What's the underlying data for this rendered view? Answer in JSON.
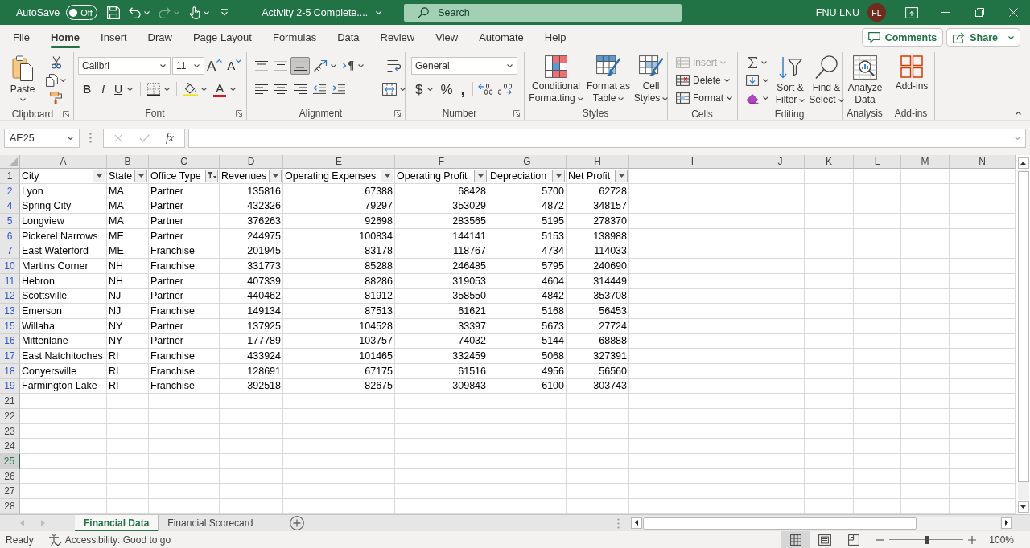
{
  "title_bar": {
    "autosave_label": "AutoSave",
    "autosave": {
      "on": false,
      "label": "Off"
    },
    "quick_access": [
      {
        "kind": "save",
        "disabled": false
      },
      {
        "kind": "undo",
        "disabled": false
      },
      {
        "kind": "redo",
        "disabled": true
      },
      {
        "kind": "touch",
        "disabled": false
      },
      {
        "kind": "customize",
        "disabled": false
      }
    ],
    "document_title": "Activity 2-5 Complete....",
    "search": {
      "placeholder": "Search"
    },
    "user_name": "FNU LNU",
    "avatar_initials": "FL"
  },
  "ribbon_tabs": [
    {
      "label": "File",
      "selected": false
    },
    {
      "label": "Home",
      "selected": true
    },
    {
      "label": "Insert",
      "selected": false
    },
    {
      "label": "Draw",
      "selected": false
    },
    {
      "label": "Page Layout",
      "selected": false
    },
    {
      "label": "Formulas",
      "selected": false
    },
    {
      "label": "Data",
      "selected": false
    },
    {
      "label": "Review",
      "selected": false
    },
    {
      "label": "View",
      "selected": false
    },
    {
      "label": "Automate",
      "selected": false
    },
    {
      "label": "Help",
      "selected": false
    }
  ],
  "ribbon_actions": {
    "comments": "Comments",
    "share": "Share"
  },
  "ribbon": {
    "clipboard": {
      "label": "Clipboard",
      "paste": "Paste"
    },
    "font": {
      "label": "Font",
      "font_name": "Calibri",
      "font_size": "11",
      "grow": "A",
      "shrink": "A",
      "bold": "B",
      "italic": "I",
      "underline": "U",
      "font_color": "A"
    },
    "alignment": {
      "label": "Alignment",
      "vertical": [
        {
          "kind": "top",
          "selected": false
        },
        {
          "kind": "middle",
          "selected": false
        },
        {
          "kind": "bottom",
          "selected": true
        }
      ],
      "horizontal": [
        {
          "kind": "left",
          "selected": false
        },
        {
          "kind": "center",
          "selected": false
        },
        {
          "kind": "right",
          "selected": false
        }
      ]
    },
    "number": {
      "label": "Number",
      "format": "General",
      "currency": "$",
      "percent": "%",
      "comma": ","
    },
    "styles": {
      "label": "Styles",
      "buttons": [
        {
          "kind": "conditional",
          "label": "Conditional Formatting"
        },
        {
          "kind": "table",
          "label": "Format as Table"
        },
        {
          "kind": "cell",
          "label": "Cell Styles"
        }
      ]
    },
    "cells": {
      "label": "Cells",
      "buttons": [
        {
          "kind": "insert",
          "label": "Insert",
          "disabled": true
        },
        {
          "kind": "delete",
          "label": "Delete",
          "disabled": false
        },
        {
          "kind": "format",
          "label": "Format",
          "disabled": false
        }
      ]
    },
    "editing": {
      "label": "Editing",
      "buttons": [
        {
          "kind": "sort",
          "label": "Sort & Filter"
        },
        {
          "kind": "find",
          "label": "Find & Select"
        }
      ]
    },
    "analysis": {
      "label": "Analysis",
      "button": "Analyze Data"
    },
    "addins": {
      "label": "Add-ins",
      "button": "Add-ins"
    }
  },
  "formula_bar": {
    "name_box": "AE25",
    "editing": false,
    "function_label": "fx"
  },
  "sheet": {
    "columns": [
      "A",
      "B",
      "C",
      "D",
      "E",
      "F",
      "G",
      "H",
      "I",
      "J",
      "K",
      "L",
      "M",
      "N"
    ],
    "header_row": {
      "number": "1",
      "cells": [
        {
          "text": "City",
          "kind": "text",
          "filtered": false
        },
        {
          "text": "State",
          "kind": "text",
          "filtered": false
        },
        {
          "text": "Office Type",
          "kind": "text",
          "filtered": true
        },
        {
          "text": "Revenues",
          "kind": "number",
          "filtered": false
        },
        {
          "text": "Operating Expenses",
          "kind": "number",
          "filtered": false
        },
        {
          "text": "Operating Profit",
          "kind": "number",
          "filtered": false
        },
        {
          "text": "Depreciation",
          "kind": "number",
          "filtered": false
        },
        {
          "text": "Net Profit",
          "kind": "number",
          "filtered": false
        }
      ]
    },
    "rows": [
      {
        "number": "2",
        "filtered": true,
        "selected": false,
        "cells": [
          "Lyon",
          "MA",
          "Partner",
          "135816",
          "67388",
          "68428",
          "5700",
          "62728"
        ]
      },
      {
        "number": "4",
        "filtered": true,
        "selected": false,
        "cells": [
          "Spring City",
          "MA",
          "Partner",
          "432326",
          "79297",
          "353029",
          "4872",
          "348157"
        ]
      },
      {
        "number": "5",
        "filtered": true,
        "selected": false,
        "cells": [
          "Longview",
          "MA",
          "Partner",
          "376263",
          "92698",
          "283565",
          "5195",
          "278370"
        ]
      },
      {
        "number": "6",
        "filtered": true,
        "selected": false,
        "cells": [
          "Pickerel Narrows",
          "ME",
          "Partner",
          "244975",
          "100834",
          "144141",
          "5153",
          "138988"
        ]
      },
      {
        "number": "7",
        "filtered": true,
        "selected": false,
        "cells": [
          "East Waterford",
          "ME",
          "Franchise",
          "201945",
          "83178",
          "118767",
          "4734",
          "114033"
        ]
      },
      {
        "number": "10",
        "filtered": true,
        "selected": false,
        "cells": [
          "Martins Corner",
          "NH",
          "Franchise",
          "331773",
          "85288",
          "246485",
          "5795",
          "240690"
        ]
      },
      {
        "number": "11",
        "filtered": true,
        "selected": false,
        "cells": [
          "Hebron",
          "NH",
          "Partner",
          "407339",
          "88286",
          "319053",
          "4604",
          "314449"
        ]
      },
      {
        "number": "12",
        "filtered": true,
        "selected": false,
        "cells": [
          "Scottsville",
          "NJ",
          "Partner",
          "440462",
          "81912",
          "358550",
          "4842",
          "353708"
        ]
      },
      {
        "number": "13",
        "filtered": true,
        "selected": false,
        "cells": [
          "Emerson",
          "NJ",
          "Franchise",
          "149134",
          "87513",
          "61621",
          "5168",
          "56453"
        ]
      },
      {
        "number": "15",
        "filtered": true,
        "selected": false,
        "cells": [
          "Willaha",
          "NY",
          "Partner",
          "137925",
          "104528",
          "33397",
          "5673",
          "27724"
        ]
      },
      {
        "number": "16",
        "filtered": true,
        "selected": false,
        "cells": [
          "Mittenlane",
          "NY",
          "Partner",
          "177789",
          "103757",
          "74032",
          "5144",
          "68888"
        ]
      },
      {
        "number": "17",
        "filtered": true,
        "selected": false,
        "cells": [
          "East Natchitoches",
          "RI",
          "Franchise",
          "433924",
          "101465",
          "332459",
          "5068",
          "327391"
        ]
      },
      {
        "number": "18",
        "filtered": true,
        "selected": false,
        "cells": [
          "Conyersville",
          "RI",
          "Franchise",
          "128691",
          "67175",
          "61516",
          "4956",
          "56560"
        ]
      },
      {
        "number": "19",
        "filtered": true,
        "selected": false,
        "cells": [
          "Farmington Lake",
          "RI",
          "Franchise",
          "392518",
          "82675",
          "309843",
          "6100",
          "303743"
        ]
      },
      {
        "number": "21",
        "filtered": false,
        "selected": false
      },
      {
        "number": "22",
        "filtered": false,
        "selected": false
      },
      {
        "number": "23",
        "filtered": false,
        "selected": false
      },
      {
        "number": "24",
        "filtered": false,
        "selected": false
      },
      {
        "number": "25",
        "filtered": false,
        "selected": true
      },
      {
        "number": "26",
        "filtered": false,
        "selected": false
      },
      {
        "number": "27",
        "filtered": false,
        "selected": false
      },
      {
        "number": "28",
        "filtered": false,
        "selected": false
      }
    ]
  },
  "sheet_tabs": [
    {
      "label": "Financial Data",
      "selected": true
    },
    {
      "label": "Financial Scorecard",
      "selected": false
    }
  ],
  "status_bar": {
    "mode": "Ready",
    "accessibility": "Accessibility: Good to go",
    "views": [
      {
        "kind": "normal",
        "selected": true
      },
      {
        "kind": "page_layout",
        "selected": false
      },
      {
        "kind": "page_break",
        "selected": false
      }
    ],
    "zoom": {
      "level": 0.5,
      "reading": "100%"
    }
  }
}
